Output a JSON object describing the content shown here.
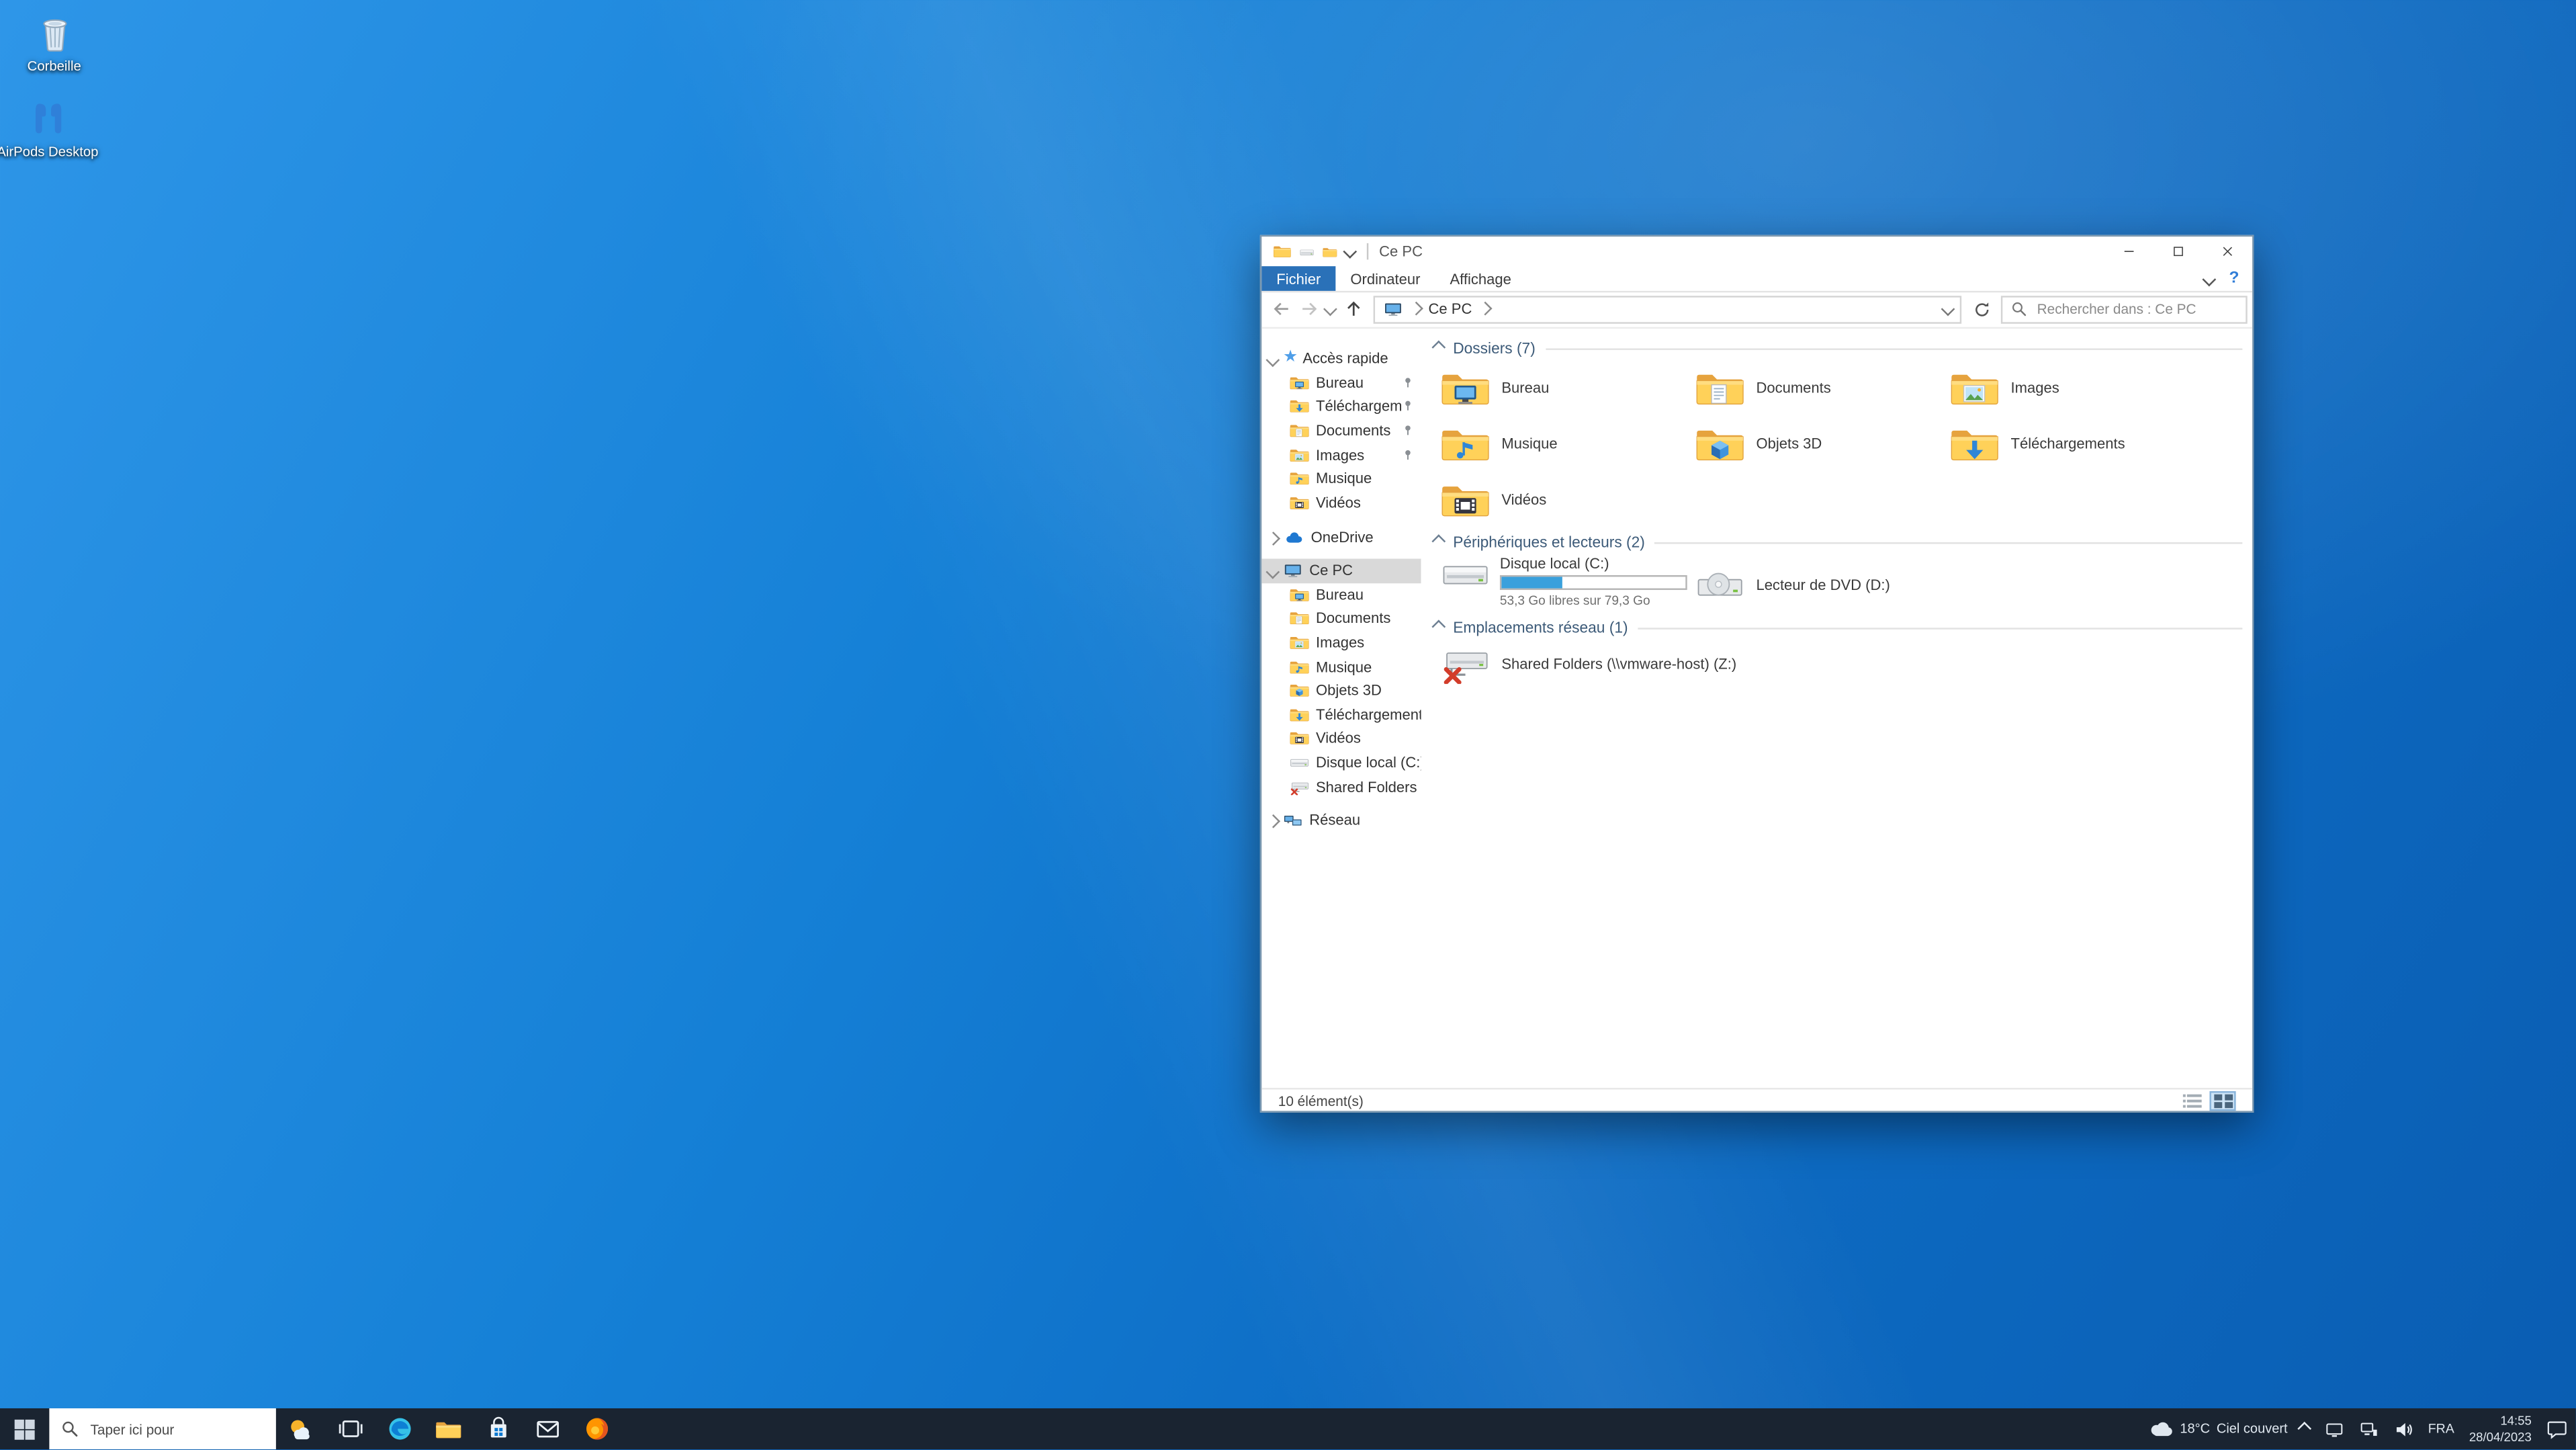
{
  "desktop": {
    "icons": [
      {
        "label": "Corbeille"
      },
      {
        "label": "AirPods Desktop"
      }
    ]
  },
  "window": {
    "title": "Ce PC",
    "tabs": {
      "file": "Fichier",
      "computer": "Ordinateur",
      "view": "Affichage"
    },
    "help_label": "?",
    "address": {
      "crumb": "Ce PC",
      "search_placeholder": "Rechercher dans : Ce PC"
    },
    "nav": {
      "quick_access": "Accès rapide",
      "qa_items": [
        {
          "label": "Bureau"
        },
        {
          "label": "Téléchargements"
        },
        {
          "label": "Documents"
        },
        {
          "label": "Images"
        },
        {
          "label": "Musique"
        },
        {
          "label": "Vidéos"
        }
      ],
      "onedrive": "OneDrive",
      "this_pc": "Ce PC",
      "pc_items": [
        {
          "label": "Bureau"
        },
        {
          "label": "Documents"
        },
        {
          "label": "Images"
        },
        {
          "label": "Musique"
        },
        {
          "label": "Objets 3D"
        },
        {
          "label": "Téléchargements"
        },
        {
          "label": "Vidéos"
        },
        {
          "label": "Disque local (C:)"
        },
        {
          "label": "Shared Folders (\\\\vm"
        }
      ],
      "network": "Réseau"
    },
    "content": {
      "folders_group": "Dossiers (7)",
      "folders": [
        {
          "name": "Bureau"
        },
        {
          "name": "Documents"
        },
        {
          "name": "Images"
        },
        {
          "name": "Musique"
        },
        {
          "name": "Objets 3D"
        },
        {
          "name": "Téléchargements"
        },
        {
          "name": "Vidéos"
        }
      ],
      "drives_group": "Périphériques et lecteurs (2)",
      "drive_c": {
        "name": "Disque local (C:)",
        "free": "53,3 Go libres sur 79,3 Go",
        "fill_style": "width:33%"
      },
      "drive_d": {
        "name": "Lecteur de DVD (D:)"
      },
      "network_group": "Emplacements réseau (1)",
      "share_z": {
        "name": "Shared Folders (\\\\vmware-host) (Z:)"
      }
    },
    "status": {
      "count": "10 élément(s)"
    }
  },
  "taskbar": {
    "search_placeholder": "Taper ici pour",
    "weather": {
      "temp": "18°C",
      "desc": "Ciel couvert"
    },
    "tray": {
      "lang": "FRA",
      "time": "14:55",
      "date": "28/04/2023"
    }
  }
}
